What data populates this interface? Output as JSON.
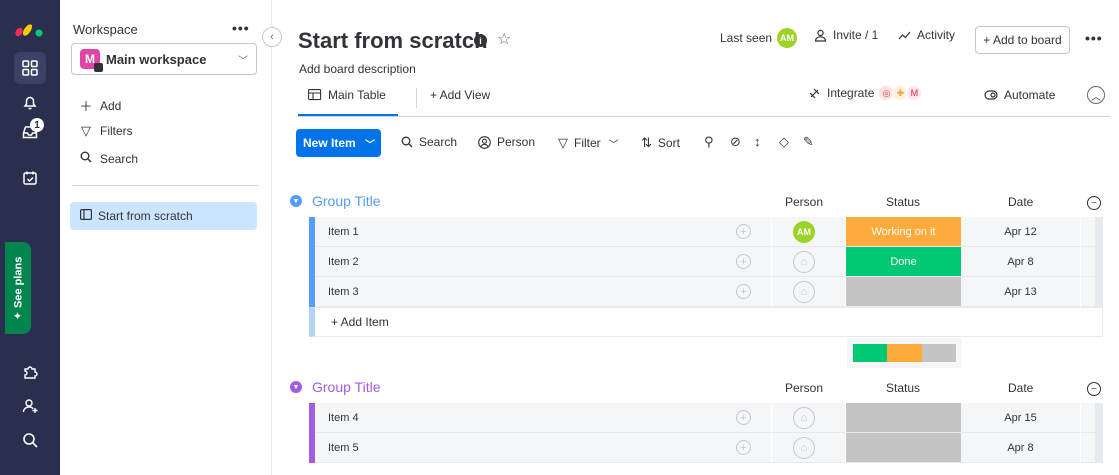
{
  "rail": {
    "notification_count": "1",
    "see_plans": "See plans",
    "colors": {
      "bg": "#292f4c",
      "see_plans": "#00854d"
    }
  },
  "workspace": {
    "label": "Workspace",
    "more": "•••",
    "avatar_letter": "M",
    "name": "Main workspace",
    "add": "Add",
    "filters": "Filters",
    "search": "Search",
    "board": "Start from scratch"
  },
  "header": {
    "title": "Start from scratch",
    "description": "Add board description",
    "last_seen": "Last seen",
    "last_seen_avatar": "AM",
    "invite": "Invite / 1",
    "activity": "Activity",
    "add_to_board": "+ Add to board",
    "more": "•••"
  },
  "tabs": {
    "main_table": "Main Table",
    "add_view": "+ Add View",
    "integrate": "Integrate",
    "automate": "Automate"
  },
  "toolbar": {
    "new_item": "New Item",
    "search": "Search",
    "person": "Person",
    "filter": "Filter",
    "sort": "Sort"
  },
  "columns": {
    "person": "Person",
    "status": "Status",
    "date": "Date"
  },
  "groups": [
    {
      "title": "Group Title",
      "color": "#579bfc",
      "items": [
        {
          "name": "Item 1",
          "person": "AM",
          "status": "Working on it",
          "status_color": "#fdab3d",
          "date": "Apr 12"
        },
        {
          "name": "Item 2",
          "person": "",
          "status": "Done",
          "status_color": "#00c875",
          "date": "Apr 8"
        },
        {
          "name": "Item 3",
          "person": "",
          "status": "",
          "status_color": "#c4c4c4",
          "date": "Apr 13"
        }
      ],
      "add_item": "+ Add Item",
      "summary": [
        {
          "color": "#00c875",
          "fraction": 0.333
        },
        {
          "color": "#fdab3d",
          "fraction": 0.333
        },
        {
          "color": "#c4c4c4",
          "fraction": 0.334
        }
      ]
    },
    {
      "title": "Group Title",
      "color": "#a25ddc",
      "items": [
        {
          "name": "Item 4",
          "person": "",
          "status": "",
          "status_color": "#c4c4c4",
          "date": "Apr 15"
        },
        {
          "name": "Item 5",
          "person": "",
          "status": "",
          "status_color": "#c4c4c4",
          "date": "Apr 8"
        }
      ]
    }
  ],
  "icons": [
    "monday-logo-icon",
    "apps-grid-icon",
    "bell-icon",
    "inbox-icon",
    "my-work-icon",
    "puzzle-icon",
    "invite-members-icon",
    "search-icon",
    "plus-icon",
    "filter-icon",
    "info-icon",
    "star-icon",
    "person-icon",
    "activity-icon",
    "table-icon",
    "integrate-icon",
    "automate-icon",
    "chevron-up-icon",
    "pin-icon",
    "eye-off-icon",
    "row-height-icon",
    "paint-bucket-icon",
    "pencil-icon",
    "add-column-icon",
    "add-subitem-icon"
  ]
}
